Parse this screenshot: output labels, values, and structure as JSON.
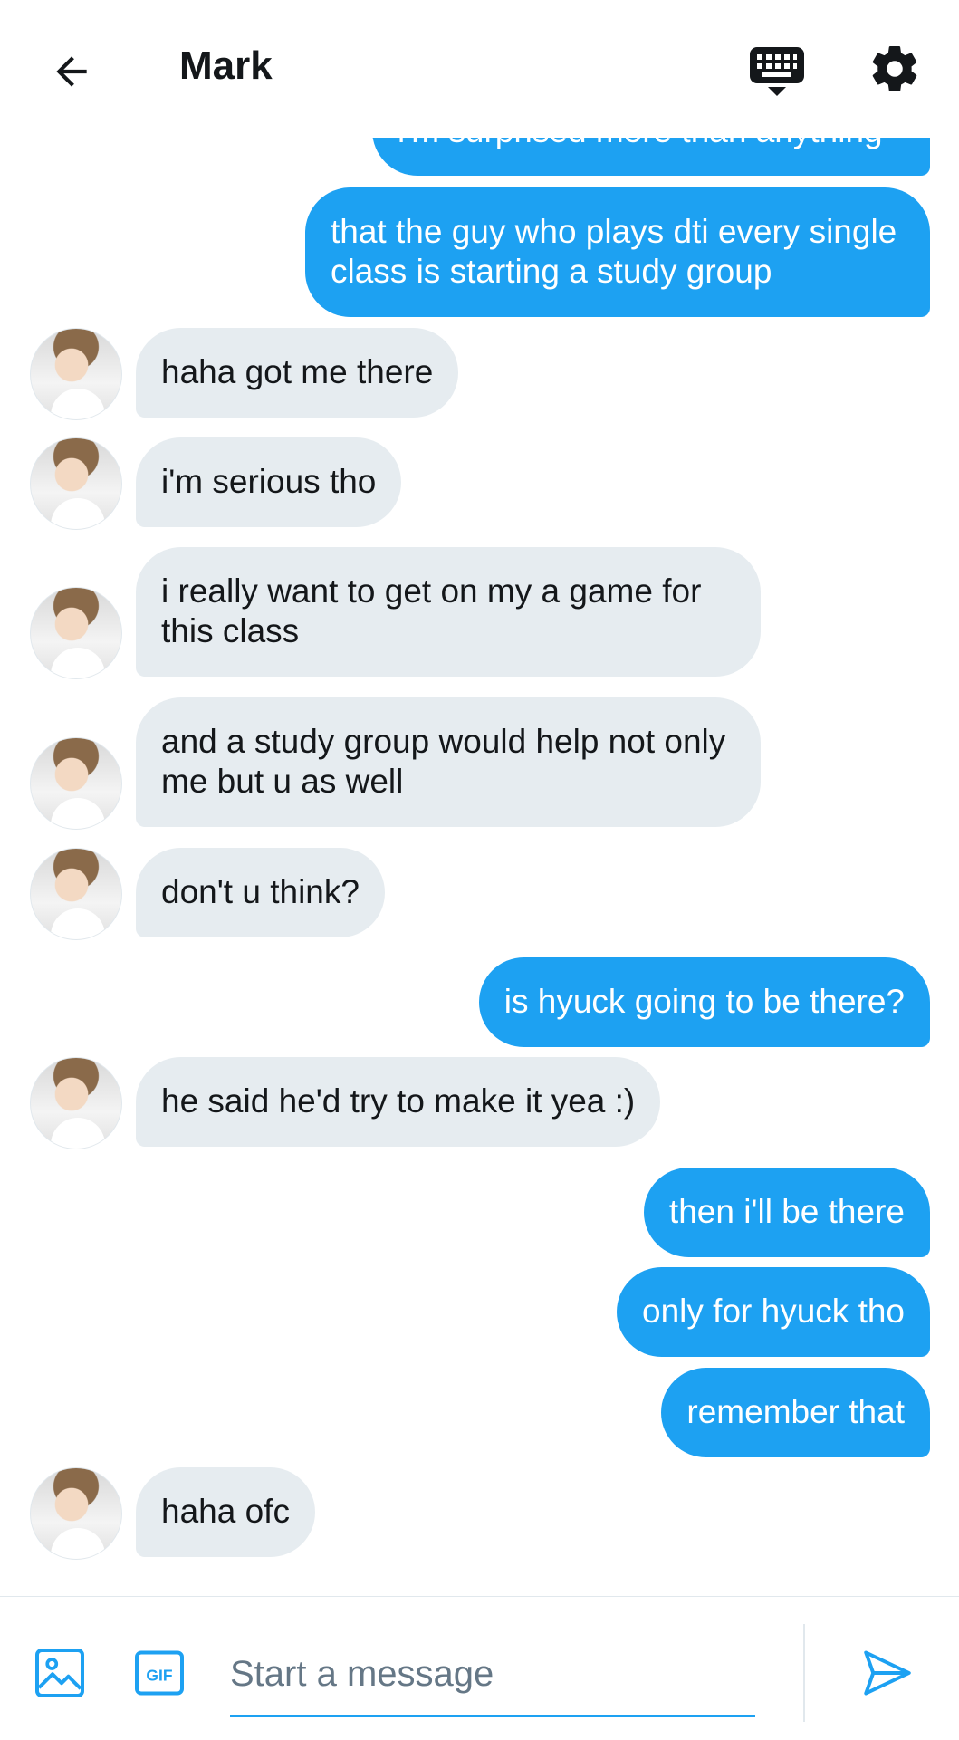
{
  "header": {
    "title": "Mark",
    "icons": {
      "back": "arrow-left-icon",
      "keyboard": "keyboard-icon",
      "settings": "gear-icon"
    }
  },
  "colors": {
    "accent": "#1da1f2",
    "received_bubble": "#e6ecf0",
    "text": "#14171a",
    "muted": "#657786"
  },
  "messages": [
    {
      "side": "sent",
      "text": "i'm surprised more than anything"
    },
    {
      "side": "sent",
      "text": "that the guy who plays dti every single class is starting a study group"
    },
    {
      "side": "received",
      "text": "haha got me there"
    },
    {
      "side": "received",
      "text": "i'm serious tho"
    },
    {
      "side": "received",
      "text": "i really want to get on my a game for this class"
    },
    {
      "side": "received",
      "text": "and a study group would help not only me but u as well"
    },
    {
      "side": "received",
      "text": "don't u think?"
    },
    {
      "side": "sent",
      "text": "is hyuck going to be there?"
    },
    {
      "side": "received",
      "text": "he said he'd try to make it yea :)"
    },
    {
      "side": "sent",
      "text": "then i'll be there"
    },
    {
      "side": "sent",
      "text": "only for hyuck tho"
    },
    {
      "side": "sent",
      "text": "remember that"
    },
    {
      "side": "received",
      "text": "haha ofc"
    }
  ],
  "composer": {
    "placeholder": "Start a message",
    "gif_label": "GIF",
    "icons": {
      "media": "image-icon",
      "gif": "gif-icon",
      "send": "send-icon"
    }
  }
}
